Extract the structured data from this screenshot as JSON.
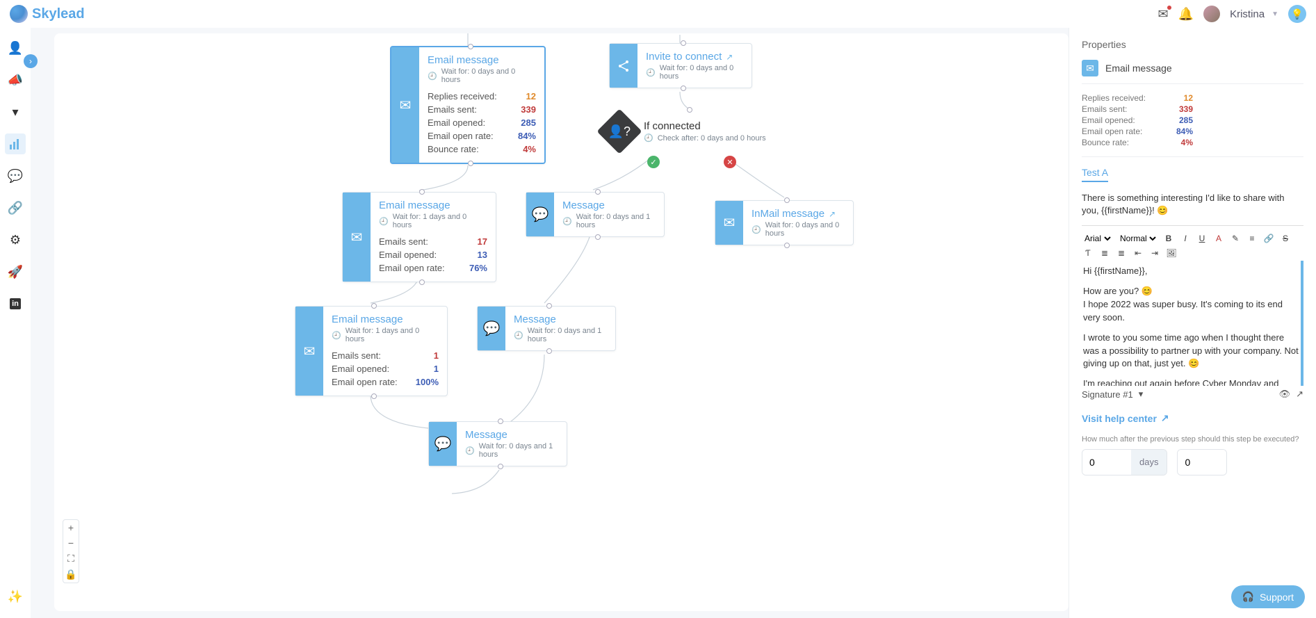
{
  "header": {
    "brand": "Skylead",
    "user_name": "Kristina"
  },
  "sidebar": {
    "items": [
      "profile",
      "campaigns",
      "filter",
      "analytics",
      "chat",
      "links",
      "settings",
      "launch",
      "linkedin"
    ]
  },
  "zoom": {
    "plus": "+",
    "minus": "−",
    "fit": "⛶",
    "lock": "🔒"
  },
  "nodes": {
    "email1": {
      "title": "Email message",
      "wait": "Wait for: 0 days and 0 hours",
      "stats": [
        {
          "label": "Replies received:",
          "value": "12",
          "cls": "orange"
        },
        {
          "label": "Emails sent:",
          "value": "339",
          "cls": "red"
        },
        {
          "label": "Email opened:",
          "value": "285",
          "cls": "blue"
        },
        {
          "label": "Email open rate:",
          "value": "84%",
          "cls": "blue"
        },
        {
          "label": "Bounce rate:",
          "value": "4%",
          "cls": "red"
        }
      ]
    },
    "invite": {
      "title": "Invite to connect",
      "wait": "Wait for: 0 days and 0 hours"
    },
    "cond": {
      "title": "If connected",
      "wait": "Check after: 0 days and 0 hours"
    },
    "email2": {
      "title": "Email message",
      "wait": "Wait for: 1 days and 0 hours",
      "stats": [
        {
          "label": "Emails sent:",
          "value": "17",
          "cls": "red"
        },
        {
          "label": "Email opened:",
          "value": "13",
          "cls": "blue"
        },
        {
          "label": "Email open rate:",
          "value": "76%",
          "cls": "blue"
        }
      ]
    },
    "msg1": {
      "title": "Message",
      "wait": "Wait for: 0 days and 1 hours"
    },
    "inmail": {
      "title": "InMail message",
      "wait": "Wait for: 0 days and 0 hours"
    },
    "email3": {
      "title": "Email message",
      "wait": "Wait for: 1 days and 0 hours",
      "stats": [
        {
          "label": "Emails sent:",
          "value": "1",
          "cls": "red"
        },
        {
          "label": "Email opened:",
          "value": "1",
          "cls": "blue"
        },
        {
          "label": "Email open rate:",
          "value": "100%",
          "cls": "blue"
        }
      ]
    },
    "msg2": {
      "title": "Message",
      "wait": "Wait for: 0 days and 1 hours"
    },
    "msg3": {
      "title": "Message",
      "wait": "Wait for: 0 days and 1 hours"
    }
  },
  "props": {
    "title": "Properties",
    "heading": "Email message",
    "stats": [
      {
        "label": "Replies received:",
        "value": "12",
        "cls": "orange"
      },
      {
        "label": "Emails sent:",
        "value": "339",
        "cls": "red"
      },
      {
        "label": "Email opened:",
        "value": "285",
        "cls": "blue"
      },
      {
        "label": "Email open rate:",
        "value": "84%",
        "cls": "blue"
      },
      {
        "label": "Bounce rate:",
        "value": "4%",
        "cls": "red"
      }
    ],
    "tab": "Test A",
    "subject": "There is something interesting I'd like to share with you, {{firstName}}! 😊",
    "font": "Arial",
    "size": "Normal",
    "body_p1": "Hi {{firstName}},",
    "body_p2": "How are you? 😊",
    "body_p3": "I hope 2022 was super busy. It's coming to its end very soon.",
    "body_p4": "I wrote to you some time ago when I thought there was a possibility to partner up with your company. Not giving up on that, just yet. 😊",
    "body_p5": "I'm reaching out again before Cyber Monday and Black Friday to let you know that we are offering a",
    "signature": "Signature #1",
    "help_link": "Visit help center",
    "wait_question": "How much after the previous step should this step be executed?",
    "wait_days_value": "0",
    "wait_days_unit": "days",
    "wait_hours_value": "0"
  },
  "support": "Support"
}
